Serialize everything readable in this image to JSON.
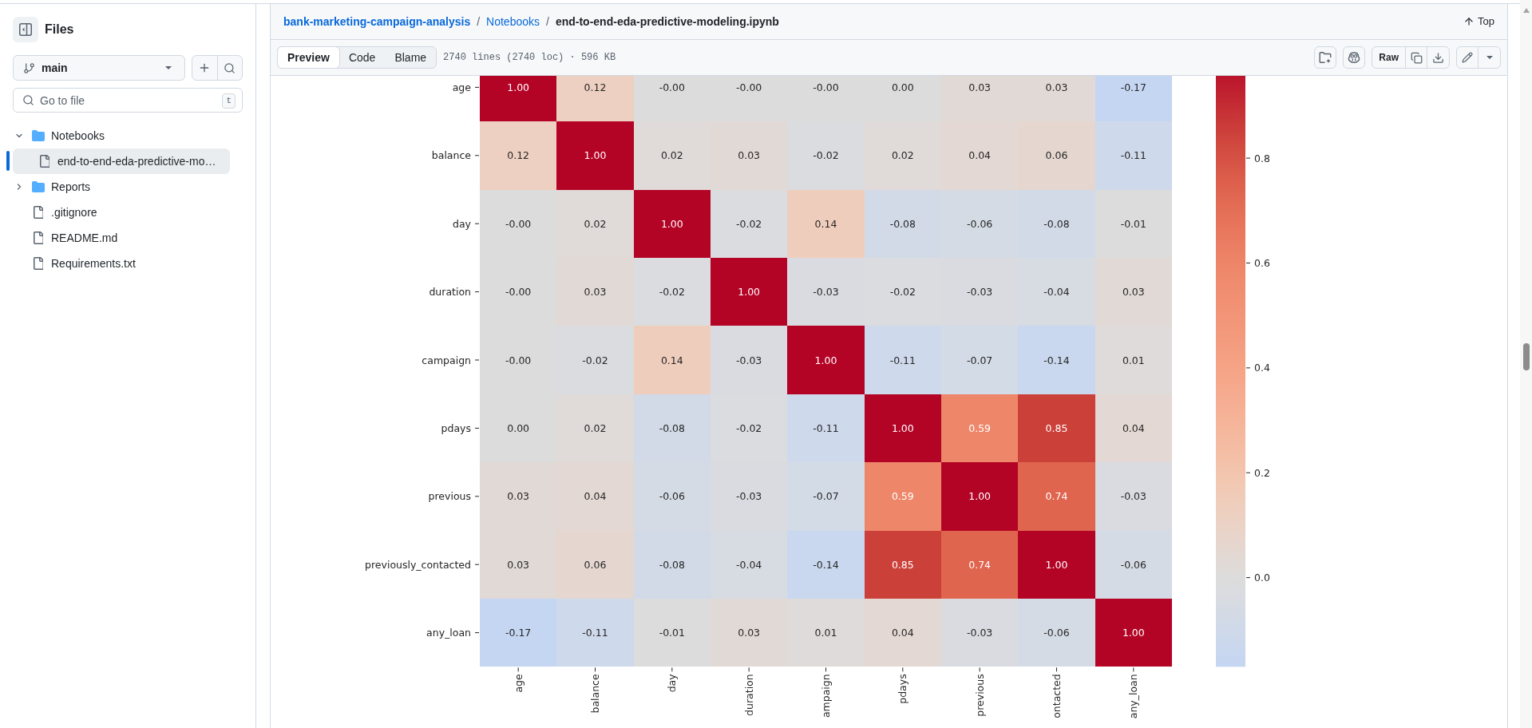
{
  "sidebar": {
    "title": "Files",
    "branch": "main",
    "file_search": {
      "placeholder": "Go to file",
      "shortcut": "t"
    },
    "tree": [
      {
        "kind": "folder",
        "name": "Notebooks",
        "expanded": true,
        "selected": false,
        "children": [
          {
            "kind": "file",
            "name": "end-to-end-eda-predictive-mo…",
            "selected": true
          }
        ]
      },
      {
        "kind": "folder",
        "name": "Reports",
        "expanded": false,
        "selected": false
      },
      {
        "kind": "file",
        "name": ".gitignore",
        "selected": false
      },
      {
        "kind": "file",
        "name": "README.md",
        "selected": false
      },
      {
        "kind": "file",
        "name": "Requirements.txt",
        "selected": false
      }
    ]
  },
  "breadcrumb": [
    {
      "kind": "repo",
      "label": "bank-marketing-campaign-analysis"
    },
    {
      "kind": "separator",
      "label": "/"
    },
    {
      "kind": "link",
      "label": "Notebooks"
    },
    {
      "kind": "separator",
      "label": "/"
    },
    {
      "kind": "current",
      "label": "end-to-end-eda-predictive-modeling.ipynb"
    }
  ],
  "top_link": "Top",
  "view_tabs": [
    {
      "label": "Preview",
      "selected": true
    },
    {
      "label": "Code",
      "selected": false
    },
    {
      "label": "Blame",
      "selected": false
    }
  ],
  "file_info": "2740 lines (2740 loc) · 596 KB",
  "raw_button": "Raw",
  "heatmap": {
    "rows": [
      {
        "label": "age",
        "values": [
          "1.00",
          "0.12",
          "-0.00",
          "-0.00",
          "-0.00",
          "0.00",
          "0.03",
          "0.03",
          "-0.17"
        ]
      },
      {
        "label": "balance",
        "values": [
          "0.12",
          "1.00",
          "0.02",
          "0.03",
          "-0.02",
          "0.02",
          "0.04",
          "0.06",
          "-0.11"
        ]
      },
      {
        "label": "day",
        "values": [
          "-0.00",
          "0.02",
          "1.00",
          "-0.02",
          "0.14",
          "-0.08",
          "-0.06",
          "-0.08",
          "-0.01"
        ]
      },
      {
        "label": "duration",
        "values": [
          "-0.00",
          "0.03",
          "-0.02",
          "1.00",
          "-0.03",
          "-0.02",
          "-0.03",
          "-0.04",
          "0.03"
        ]
      },
      {
        "label": "campaign",
        "values": [
          "-0.00",
          "-0.02",
          "0.14",
          "-0.03",
          "1.00",
          "-0.11",
          "-0.07",
          "-0.14",
          "0.01"
        ]
      },
      {
        "label": "pdays",
        "values": [
          "0.00",
          "0.02",
          "-0.08",
          "-0.02",
          "-0.11",
          "1.00",
          "0.59",
          "0.85",
          "0.04"
        ]
      },
      {
        "label": "previous",
        "values": [
          "0.03",
          "0.04",
          "-0.06",
          "-0.03",
          "-0.07",
          "0.59",
          "1.00",
          "0.74",
          "-0.03"
        ]
      },
      {
        "label": "previously_contacted",
        "values": [
          "0.03",
          "0.06",
          "-0.08",
          "-0.04",
          "-0.14",
          "0.85",
          "0.74",
          "1.00",
          "-0.06"
        ]
      },
      {
        "label": "any_loan",
        "values": [
          "-0.17",
          "-0.11",
          "-0.01",
          "0.03",
          "0.01",
          "0.04",
          "-0.03",
          "-0.06",
          "1.00"
        ]
      }
    ],
    "column_labels": [
      "age",
      "balance",
      "day",
      "duration",
      "ampaign",
      "pdays",
      "previous",
      "ontacted",
      "any_loan"
    ],
    "colorbar_ticks": [
      "0.8",
      "0.6",
      "0.4",
      "0.2",
      "0.0"
    ]
  }
}
